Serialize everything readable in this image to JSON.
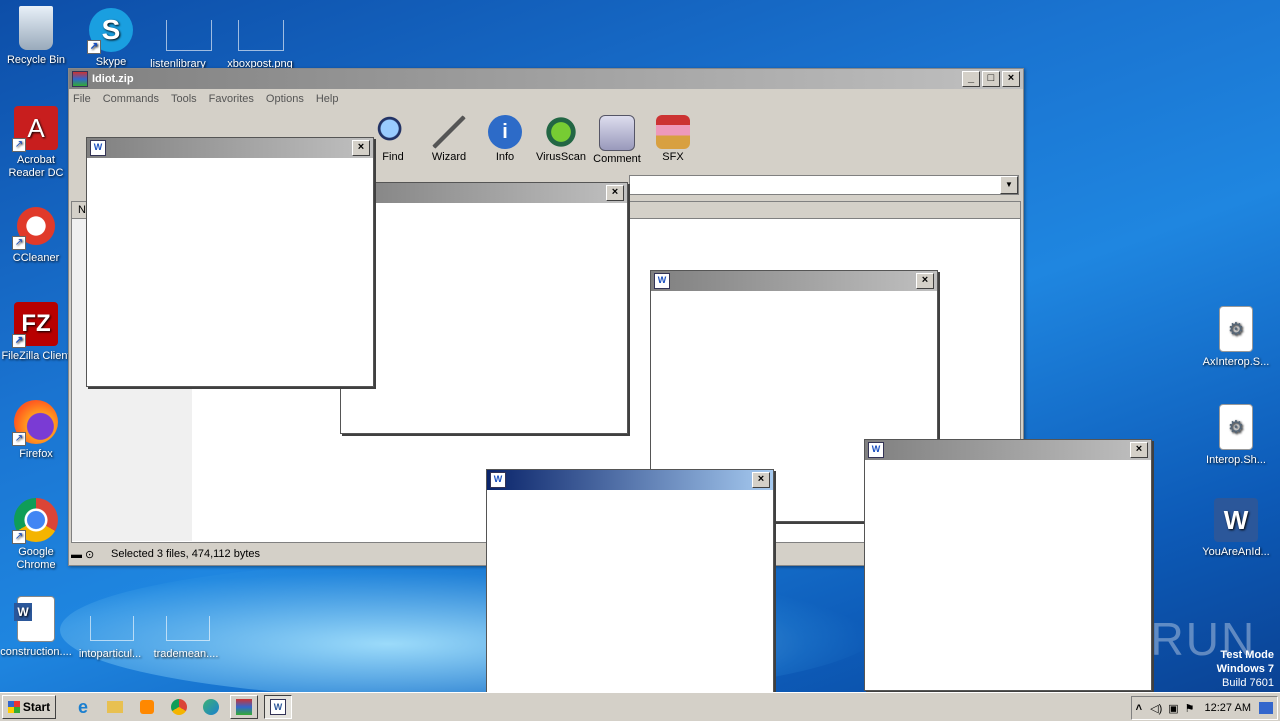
{
  "desktop": {
    "icons": [
      {
        "label": "Recycle Bin",
        "icon": "recycle-bin-icon"
      },
      {
        "label": "Skype",
        "icon": "skype-icon"
      },
      {
        "label": "listenlibrary",
        "icon": "blank-file-icon"
      },
      {
        "label": "xboxpost.png",
        "icon": "blank-file-icon"
      },
      {
        "label": "Acrobat Reader DC",
        "icon": "acrobat-icon"
      },
      {
        "label": "CCleaner",
        "icon": "ccleaner-icon"
      },
      {
        "label": "FileZilla Client",
        "icon": "filezilla-icon"
      },
      {
        "label": "Firefox",
        "icon": "firefox-icon"
      },
      {
        "label": "Google Chrome",
        "icon": "chrome-icon"
      },
      {
        "label": "construction....",
        "icon": "word-doc-icon"
      },
      {
        "label": "intoparticul...",
        "icon": "blank-file-icon"
      },
      {
        "label": "trademean....",
        "icon": "blank-file-icon"
      },
      {
        "label": "AxInterop.S...",
        "icon": "dll-file-icon"
      },
      {
        "label": "Interop.Sh...",
        "icon": "dll-file-icon"
      },
      {
        "label": "YouAreAnId...",
        "icon": "word-icon"
      }
    ],
    "watermark": "ANY RUN",
    "os_notice": [
      "Test Mode",
      "Windows 7",
      "Build 7601"
    ]
  },
  "winrar": {
    "title": "Idiot.zip",
    "menu": [
      "File",
      "Commands",
      "Tools",
      "Favorites",
      "Options",
      "Help"
    ],
    "toolbar": [
      "Find",
      "Wizard",
      "Info",
      "VirusScan",
      "Comment",
      "SFX"
    ],
    "list_header_first": "N",
    "status": "Selected 3 files, 474,112 bytes"
  },
  "taskbar": {
    "start": "Start",
    "clock": "12:27 AM",
    "tray_chevron": "˄"
  },
  "colors": {
    "accent": "#0a246a",
    "desktop": "#1a74d1"
  }
}
